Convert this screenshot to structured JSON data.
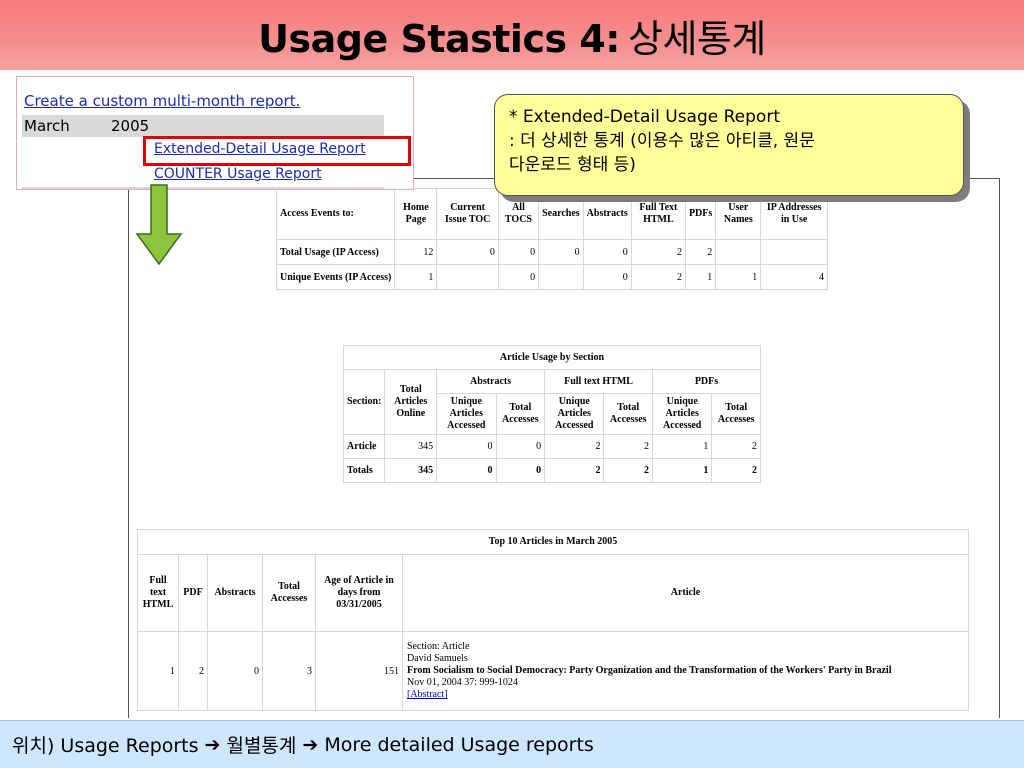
{
  "slide": {
    "title_en": "Usage Stastics 4:",
    "title_ko": "상세통계"
  },
  "nav": {
    "custom_report_link": "Create a custom multi-month report.",
    "month": "March",
    "year": "2005",
    "extended_link": "Extended-Detail Usage Report",
    "counter_link": "COUNTER Usage Report"
  },
  "callout": {
    "line1": "* Extended-Detail Usage Report",
    "line2": ": 더 상세한 통계 (이용수 많은 아티클, 원문",
    "line3": "다운로드 형태 등)"
  },
  "access_table": {
    "headers": [
      "Access Events to:",
      "Home Page",
      "Current Issue TOC",
      "All TOCS",
      "Searches",
      "Abstracts",
      "Full Text HTML",
      "PDFs",
      "User Names",
      "IP Addresses in Use"
    ],
    "rows": [
      {
        "label": "Total Usage (IP Access)",
        "cells": [
          "12",
          "0",
          "0",
          "0",
          "0",
          "2",
          "2",
          "",
          ""
        ]
      },
      {
        "label": "Unique Events (IP Access)",
        "cells": [
          "1",
          "",
          "0",
          "",
          "0",
          "2",
          "1",
          "1",
          "4"
        ]
      }
    ]
  },
  "section_table": {
    "caption": "Article Usage by Section",
    "section_label": "Section:",
    "total_online": "Total Articles Online",
    "groups": [
      "Abstracts",
      "Full text HTML",
      "PDFs"
    ],
    "sub_unique": "Unique Articles Accessed",
    "sub_total": "Total Accesses",
    "rows": [
      {
        "label": "Article",
        "cells": [
          "345",
          "0",
          "0",
          "2",
          "2",
          "1",
          "2"
        ]
      },
      {
        "label": "Totals",
        "cells": [
          "345",
          "0",
          "0",
          "2",
          "2",
          "1",
          "2"
        ]
      }
    ]
  },
  "top10_table": {
    "caption": "Top 10 Articles in March 2005",
    "headers": [
      "Full text HTML",
      "PDF",
      "Abstracts",
      "Total Accesses",
      "Age of Article in days from 03/31/2005",
      "Article"
    ],
    "row": {
      "cells": [
        "1",
        "2",
        "0",
        "3",
        "151"
      ],
      "section": "Section: Article",
      "author": "David Samuels",
      "title": "From Socialism to Social Democracy: Party Organization and the Transformation of the Workers' Party in Brazil",
      "citation": "Nov 01, 2004 37: 999-1024",
      "abstract_link": "[Abstract]"
    }
  },
  "footer": {
    "prefix": "위치) Usage Reports",
    "middle": "월별통계",
    "suffix": "More detailed Usage reports",
    "arrow": "➔"
  },
  "colors": {
    "title_bar": "#f77a7a",
    "callout_bg": "#ffff99",
    "highlight": "#e00000",
    "arrow_fill": "#8cc63f",
    "footer_bg": "#cfe6ff",
    "link": "#1a2db0"
  }
}
